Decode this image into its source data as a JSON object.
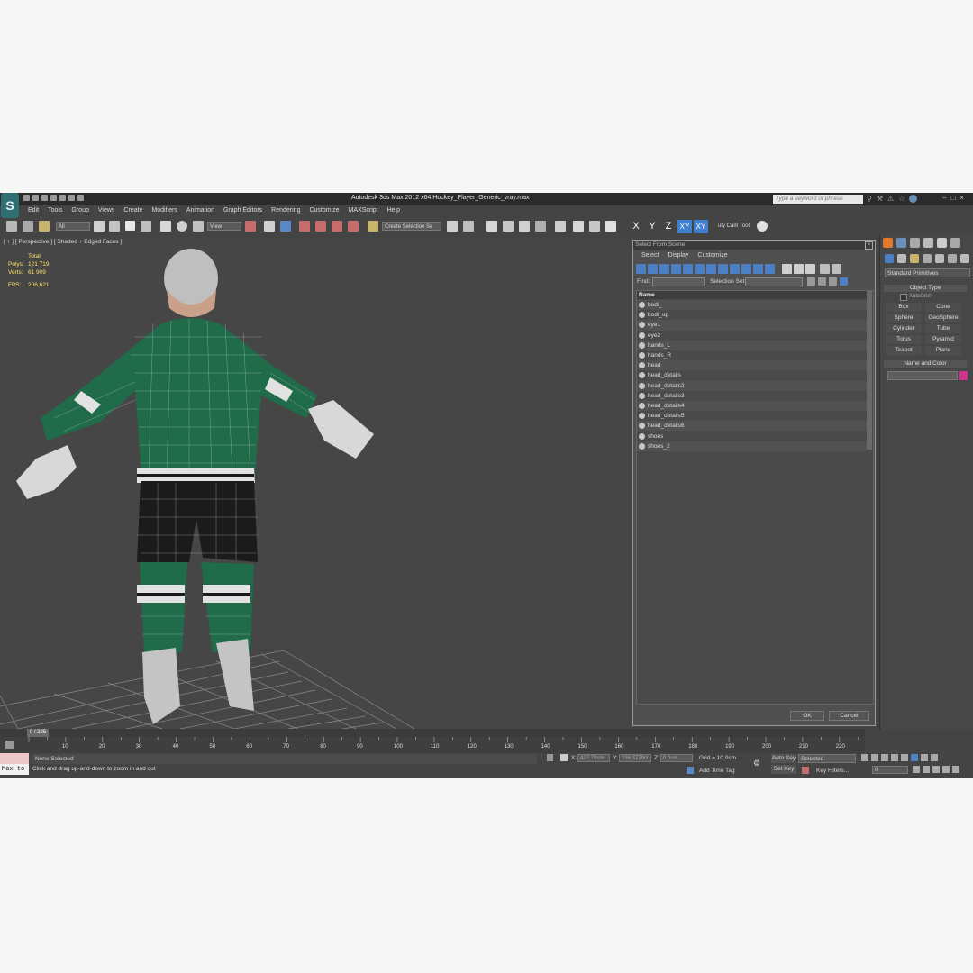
{
  "titlebar": {
    "app_title": "Autodesk 3ds Max  2012 x64    Hockey_Player_Generic_vray.max",
    "search_placeholder": "Type a keyword or phrase"
  },
  "menubar": [
    "Edit",
    "Tools",
    "Group",
    "Views",
    "Create",
    "Modifiers",
    "Animation",
    "Graph Editors",
    "Rendering",
    "Customize",
    "MAXScript",
    "Help"
  ],
  "toolbar": {
    "selection_filter": "All",
    "reference_coord": "View",
    "named_selection": "Create Selection Se",
    "axis_buttons": [
      "X",
      "Y",
      "Z",
      "XY",
      "XY"
    ],
    "camera_tool": "uty Cam Tool"
  },
  "viewport": {
    "label": "[ + ] [ Perspective ] [ Shaded + Edged Faces ]",
    "stats": {
      "total_label": "Total",
      "polys_label": "Polys:",
      "polys_value": "121 719",
      "verts_label": "Verts:",
      "verts_value": "61 909",
      "fps_label": "FPS:",
      "fps_value": "206,621"
    }
  },
  "dialog": {
    "title": "Select From Scene",
    "menu": [
      "Select",
      "Display",
      "Customize"
    ],
    "find_label": "Find:",
    "selection_set_label": "Selection Set:",
    "column_header": "Name",
    "objects": [
      "bodi_",
      "bodi_up",
      "eye1",
      "eye2",
      "hands_L",
      "hands_R",
      "head",
      "head_details",
      "head_details2",
      "head_details3",
      "head_details4",
      "head_details5",
      "head_details6",
      "shoes",
      "shoes_2"
    ],
    "ok_label": "OK",
    "cancel_label": "Cancel"
  },
  "command_panel": {
    "category": "Standard Primitives",
    "object_type_header": "Object Type",
    "autogrid_label": "AutoGrid",
    "primitives": [
      "Box",
      "Cone",
      "Sphere",
      "GeoSphere",
      "Cylinder",
      "Tube",
      "Torus",
      "Pyramid",
      "Teapot",
      "Plane"
    ],
    "name_color_header": "Name and Color",
    "object_color": "#d1348e"
  },
  "timeline": {
    "frame_indicator": "0 / 225",
    "ticks": [
      "10",
      "20",
      "30",
      "40",
      "50",
      "60",
      "70",
      "80",
      "90",
      "100",
      "110",
      "120",
      "130",
      "140",
      "150",
      "160",
      "170",
      "180",
      "190",
      "200",
      "210",
      "220"
    ]
  },
  "statusbar": {
    "maxscript_label": "Max to",
    "selection_status": "None Selected",
    "prompt": "Click and drag up-and-down to zoom in and out",
    "x_label": "X:",
    "x_value": "427,79cm",
    "y_label": "Y:",
    "y_value": "236,3779cl",
    "z_label": "Z:",
    "z_value": "0,0cm",
    "grid": "Grid = 10,0cm",
    "add_time_tag": "Add Time Tag",
    "auto_key": "Auto Key",
    "set_key": "Set Key",
    "key_mode": "Selected",
    "key_filters": "Key Filters...",
    "current_frame": "0"
  }
}
